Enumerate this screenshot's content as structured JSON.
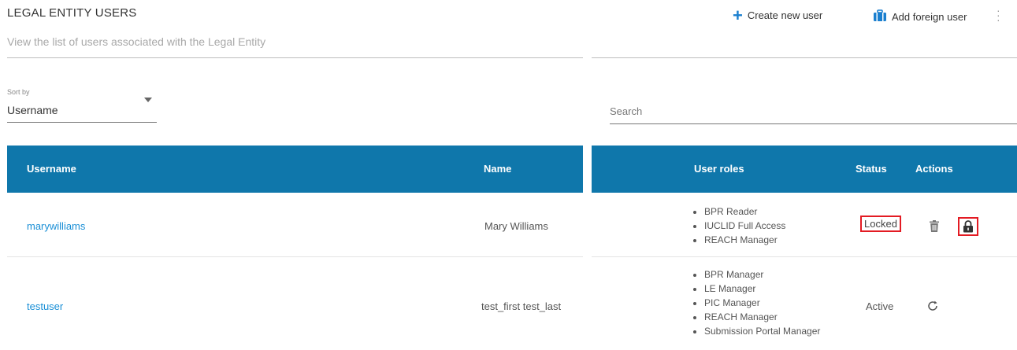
{
  "header": {
    "title": "LEGAL ENTITY USERS",
    "subtitle": "View the list of users associated with the Legal Entity",
    "create_user_label": "Create new user",
    "add_foreign_user_label": "Add foreign user"
  },
  "sort": {
    "label": "Sort by",
    "value": "Username"
  },
  "search": {
    "placeholder": "Search"
  },
  "table": {
    "columns": {
      "username": "Username",
      "name": "Name",
      "roles": "User roles",
      "status": "Status",
      "actions": "Actions"
    },
    "rows": [
      {
        "username": "marywilliams",
        "name": "Mary Williams",
        "roles": [
          "BPR Reader",
          "IUCLID Full Access",
          "REACH Manager"
        ],
        "status": "Locked"
      },
      {
        "username": "testuser",
        "name": "test_first test_last",
        "roles": [
          "BPR Manager",
          "LE Manager",
          "PIC Manager",
          "REACH Manager",
          "Submission Portal Manager"
        ],
        "status": "Active"
      }
    ]
  },
  "colors": {
    "header_bg": "#0f77ab",
    "link": "#1a8fd6",
    "accent": "#1a7fcf",
    "highlight_border": "#e31b23"
  }
}
